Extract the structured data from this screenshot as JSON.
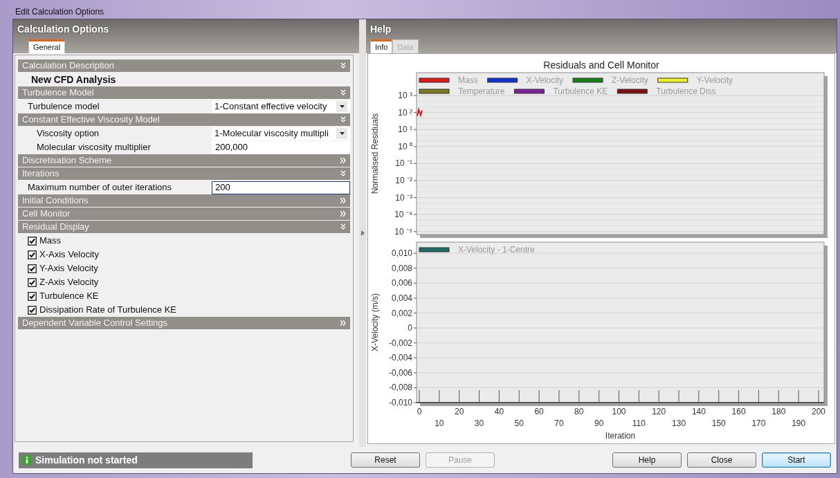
{
  "window": {
    "title": "Edit Calculation Options"
  },
  "left_panel": {
    "title": "Calculation Options",
    "tabs": [
      {
        "label": "General",
        "selected": true
      }
    ],
    "sections": [
      {
        "title": "Calculation Description",
        "expanded": true,
        "items": [
          {
            "kind": "heading",
            "text": "New CFD Analysis"
          }
        ]
      },
      {
        "title": "Turbulence Model",
        "expanded": true,
        "items": [
          {
            "kind": "dropdown",
            "label": "Turbulence model",
            "value": "1-Constant effective velocity"
          },
          {
            "kind": "subsection",
            "title": "Constant Effective Viscosity Model",
            "expanded": true,
            "items": [
              {
                "kind": "dropdown",
                "label": "Viscosity option",
                "value": "1-Molecular viscosity multipli"
              },
              {
                "kind": "field",
                "label": "Molecular viscosity multiplier",
                "value": "200,000",
                "focused": false
              }
            ]
          }
        ]
      },
      {
        "title": "Discretisation Scheme",
        "expanded": false
      },
      {
        "title": "Iterations",
        "expanded": true,
        "items": [
          {
            "kind": "field",
            "label": "Maximum number of outer iterations",
            "value": "200",
            "focused": true
          }
        ]
      },
      {
        "title": "Initial Conditions",
        "expanded": false
      },
      {
        "title": "Cell Monitor",
        "expanded": false
      },
      {
        "title": "Residual Display",
        "expanded": true,
        "items": [
          {
            "kind": "checkbox",
            "label": "Mass",
            "checked": true
          },
          {
            "kind": "checkbox",
            "label": "X-Axis Velocity",
            "checked": true
          },
          {
            "kind": "checkbox",
            "label": "Y-Axis Velocity",
            "checked": true
          },
          {
            "kind": "checkbox",
            "label": "Z-Axis Velocity",
            "checked": true
          },
          {
            "kind": "checkbox",
            "label": "Turbulence KE",
            "checked": true
          },
          {
            "kind": "checkbox",
            "label": "Dissipation Rate of Turbulence KE",
            "checked": true
          }
        ]
      },
      {
        "title": "Dependent Variable Control Settings",
        "expanded": false
      }
    ]
  },
  "help_panel": {
    "title": "Help",
    "tabs": [
      {
        "label": "Info",
        "selected": true
      },
      {
        "label": "Data",
        "selected": false
      }
    ],
    "heading": "Residuals and Cell Monitor",
    "residual_plot": {
      "ylabel": "Normalised Residuals",
      "y_labels": [
        "10 ³",
        "10 ²",
        "10 ¹",
        "10 ⁰",
        "10 ⁻¹",
        "10 ⁻²",
        "10 ⁻³",
        "10 ⁻⁴",
        "10 ⁻⁵"
      ],
      "legend": [
        {
          "name": "Mass",
          "color": "#e01818"
        },
        {
          "name": "X-Velocity",
          "color": "#1030d8"
        },
        {
          "name": "Z-Velocity",
          "color": "#188018"
        },
        {
          "name": "Y-Velocity",
          "color": "#f0f020"
        },
        {
          "name": "Temperature",
          "color": "#7a7a20"
        },
        {
          "name": "Turbulence KE",
          "color": "#8020a0"
        },
        {
          "name": "Turbulence Diss",
          "color": "#801010"
        }
      ]
    },
    "charts": [
      {
        "chart_data": {
          "type": "line",
          "xlabel": "Iteration",
          "ylabel": "X-Velocity (m/s)",
          "grid": true,
          "ylim": [
            -0.01,
            0.0115
          ],
          "categories": [
            "0",
            "10",
            "20",
            "30",
            "40",
            "50",
            "60",
            "70",
            "80",
            "90",
            "100",
            "110",
            "120",
            "130",
            "140",
            "150",
            "160",
            "170",
            "180",
            "190",
            "200"
          ],
          "yticks": [
            {
              "value": 0.01,
              "label": "0,010"
            },
            {
              "value": 0.008,
              "label": "0,008"
            },
            {
              "value": 0.006,
              "label": "0,006"
            },
            {
              "value": 0.004,
              "label": "0,004"
            },
            {
              "value": 0.002,
              "label": "0,002"
            },
            {
              "value": 0,
              "label": "0"
            },
            {
              "value": -0.002,
              "label": "-0,002"
            },
            {
              "value": -0.004,
              "label": "-0,004"
            },
            {
              "value": -0.006,
              "label": "-0,006"
            },
            {
              "value": -0.008,
              "label": "-0,008"
            },
            {
              "value": -0.01,
              "label": "-0,010"
            }
          ],
          "series": [
            {
              "name": "X-Velocity - 1-Centre",
              "color": "#1f6b6b",
              "values": [
                null,
                null,
                null,
                null,
                null,
                null,
                null,
                null,
                null,
                null,
                null,
                null,
                null,
                null,
                null,
                null,
                null,
                null,
                null,
                null,
                null
              ]
            }
          ]
        }
      }
    ]
  },
  "status": {
    "text": "Simulation not started"
  },
  "buttons_left": [
    {
      "label": "Reset",
      "disabled": false,
      "default": false
    },
    {
      "label": "Pause",
      "disabled": true,
      "default": false
    }
  ],
  "buttons_right": [
    {
      "label": "Help",
      "disabled": false,
      "default": false
    },
    {
      "label": "Close",
      "disabled": false,
      "default": false
    },
    {
      "label": "Start",
      "disabled": false,
      "default": true
    }
  ]
}
